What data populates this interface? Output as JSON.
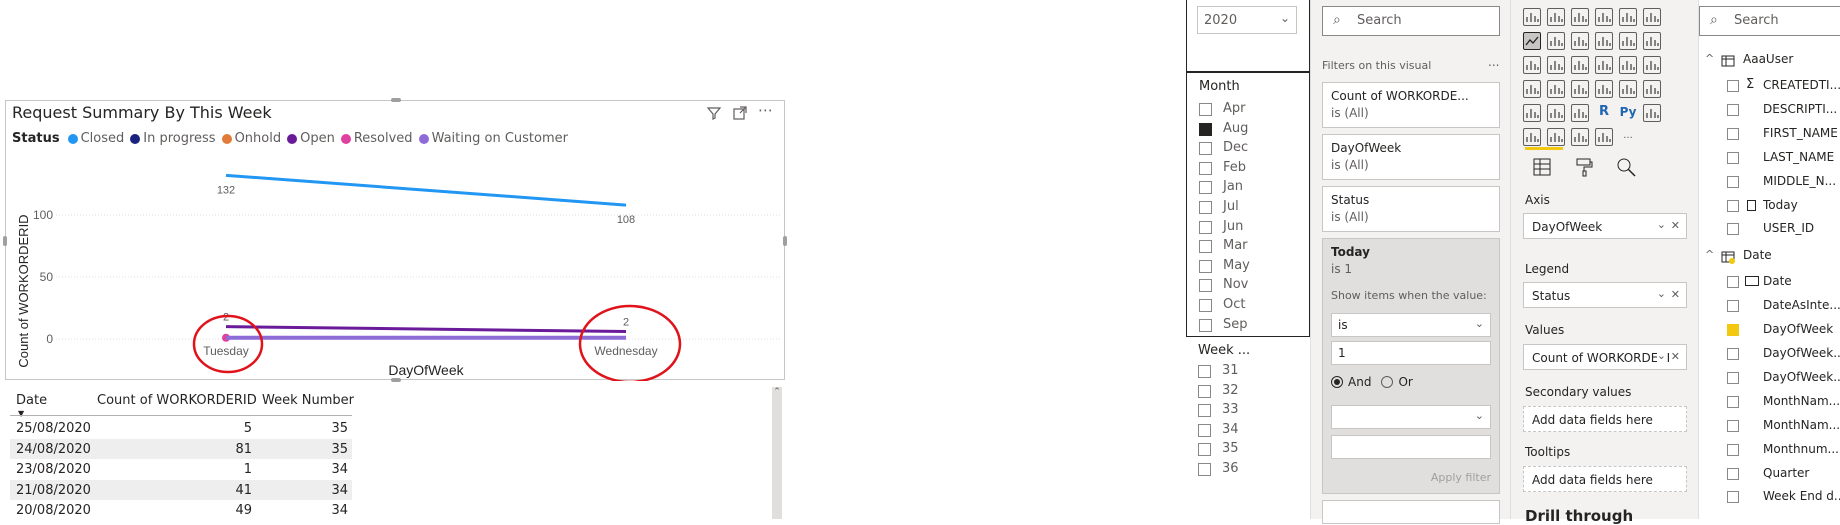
{
  "chart": {
    "title": "Request Summary By This Week",
    "legend_title": "Status",
    "x_axis_label": "DayOfWeek",
    "y_axis_label": "Count of WORKORDERID"
  },
  "chart_data": {
    "type": "line",
    "title": "Request Summary By This Week",
    "xlabel": "DayOfWeek",
    "ylabel": "Count of WORKORDERID",
    "categories": [
      "Tuesday",
      "Wednesday"
    ],
    "y_ticks": [
      "100",
      "50",
      "0"
    ],
    "ylim": [
      0,
      150
    ],
    "legend_position": "top-left",
    "series": [
      {
        "name": "Closed",
        "color": "#2196F3",
        "values": [
          132,
          108
        ],
        "labels": [
          "132",
          "108"
        ]
      },
      {
        "name": "In progress",
        "color": "#1a237e",
        "values": [
          0,
          0
        ]
      },
      {
        "name": "Onhold",
        "color": "#e07b39",
        "values": [
          0,
          0
        ]
      },
      {
        "name": "Open",
        "color": "#6a1b9a",
        "values": [
          10,
          6
        ],
        "labels": [
          "2",
          "2"
        ]
      },
      {
        "name": "Resolved",
        "color": "#e040a0",
        "values": [
          1,
          1
        ]
      },
      {
        "name": "Waiting on Customer",
        "color": "#8e6cd8",
        "values": [
          1,
          1
        ]
      }
    ],
    "annotations": [
      "red circle around Tuesday",
      "red circle around Wednesday"
    ]
  },
  "table": {
    "headers": [
      "Date",
      "Count of WORKORDERID",
      "Week Number"
    ],
    "rows": [
      [
        "25/08/2020",
        "5",
        "35"
      ],
      [
        "24/08/2020",
        "81",
        "35"
      ],
      [
        "23/08/2020",
        "1",
        "34"
      ],
      [
        "21/08/2020",
        "41",
        "34"
      ],
      [
        "20/08/2020",
        "49",
        "34"
      ]
    ]
  },
  "year_slicer": {
    "value": "2020"
  },
  "month_slicer": {
    "title": "Month",
    "items": [
      {
        "label": "Apr",
        "checked": false
      },
      {
        "label": "Aug",
        "checked": true
      },
      {
        "label": "Dec",
        "checked": false
      },
      {
        "label": "Feb",
        "checked": false
      },
      {
        "label": "Jan",
        "checked": false
      },
      {
        "label": "Jul",
        "checked": false
      },
      {
        "label": "Jun",
        "checked": false
      },
      {
        "label": "Mar",
        "checked": false
      },
      {
        "label": "May",
        "checked": false
      },
      {
        "label": "Nov",
        "checked": false
      },
      {
        "label": "Oct",
        "checked": false
      },
      {
        "label": "Sep",
        "checked": false
      }
    ]
  },
  "week_slicer": {
    "title": "Week ...",
    "items": [
      "31",
      "32",
      "33",
      "34",
      "35",
      "36"
    ]
  },
  "filters": {
    "search_placeholder": "Search",
    "section_title": "Filters on this visual",
    "more": "...",
    "cards": [
      {
        "title": "Count of WORKORDE...",
        "sub": "is (All)"
      },
      {
        "title": "DayOfWeek",
        "sub": "is (All)"
      },
      {
        "title": "Status",
        "sub": "is (All)"
      }
    ],
    "today": {
      "title": "Today",
      "sub": "is 1",
      "show_items": "Show items when the value:",
      "operator": "is",
      "value": "1",
      "and": "And",
      "or": "Or",
      "apply": "Apply filter"
    }
  },
  "viz": {
    "axis_label": "Axis",
    "axis_value": "DayOfWeek",
    "legend_label": "Legend",
    "legend_value": "Status",
    "values_label": "Values",
    "values_value": "Count of WORKORDERI",
    "secondary_label": "Secondary values",
    "secondary_placeholder": "Add data fields here",
    "tooltips_label": "Tooltips",
    "tooltips_placeholder": "Add data fields here",
    "drill_label": "Drill through",
    "r_label": "R",
    "py_label": "Py",
    "more": "..."
  },
  "fields": {
    "search_placeholder": "Search",
    "tables": [
      {
        "name": "AaaUser",
        "fields": [
          "CREATEDTI...",
          "DESCRIPTI...",
          "FIRST_NAME",
          "LAST_NAME",
          "MIDDLE_N...",
          "Today",
          "USER_ID"
        ]
      },
      {
        "name": "Date",
        "fields": [
          "Date",
          "DateAsInte...",
          "DayOfWeek",
          "DayOfWeek...",
          "DayOfWeek...",
          "MonthNam...",
          "MonthNam...",
          "Monthnum...",
          "Quarter",
          "Week End d..."
        ]
      }
    ]
  }
}
